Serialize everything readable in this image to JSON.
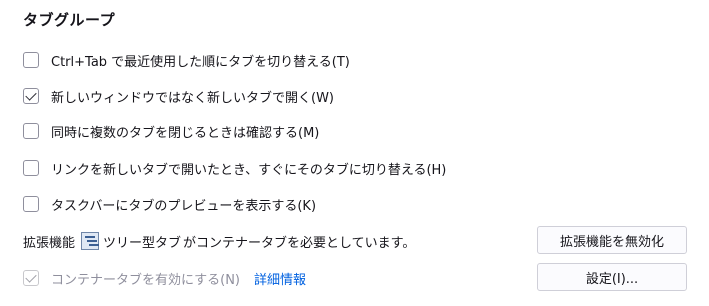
{
  "section": {
    "title": "タブグループ"
  },
  "options": [
    {
      "label": "Ctrl+Tab で最近使用した順にタブを切り替える(T)",
      "checked": false,
      "disabled": false
    },
    {
      "label": "新しいウィンドウではなく新しいタブで開く(W)",
      "checked": true,
      "disabled": false
    },
    {
      "label": "同時に複数のタブを閉じるときは確認する(M)",
      "checked": false,
      "disabled": false
    },
    {
      "label": "リンクを新しいタブで開いたとき、すぐにそのタブに切り替える(H)",
      "checked": false,
      "disabled": false
    },
    {
      "label": "タスクバーにタブのプレビューを表示する(K)",
      "checked": false,
      "disabled": false
    }
  ],
  "extension_notice": {
    "prefix": "拡張機能",
    "icon": "tree-tabs-icon",
    "name": "ツリー型タブ",
    "suffix": "がコンテナータブを必要としています。"
  },
  "containers": {
    "label": "コンテナータブを有効にする(N)",
    "checked": true,
    "disabled": true,
    "learn_more": "詳細情報"
  },
  "buttons": {
    "disable_extension": "拡張機能を無効化",
    "settings": "設定(I)..."
  }
}
